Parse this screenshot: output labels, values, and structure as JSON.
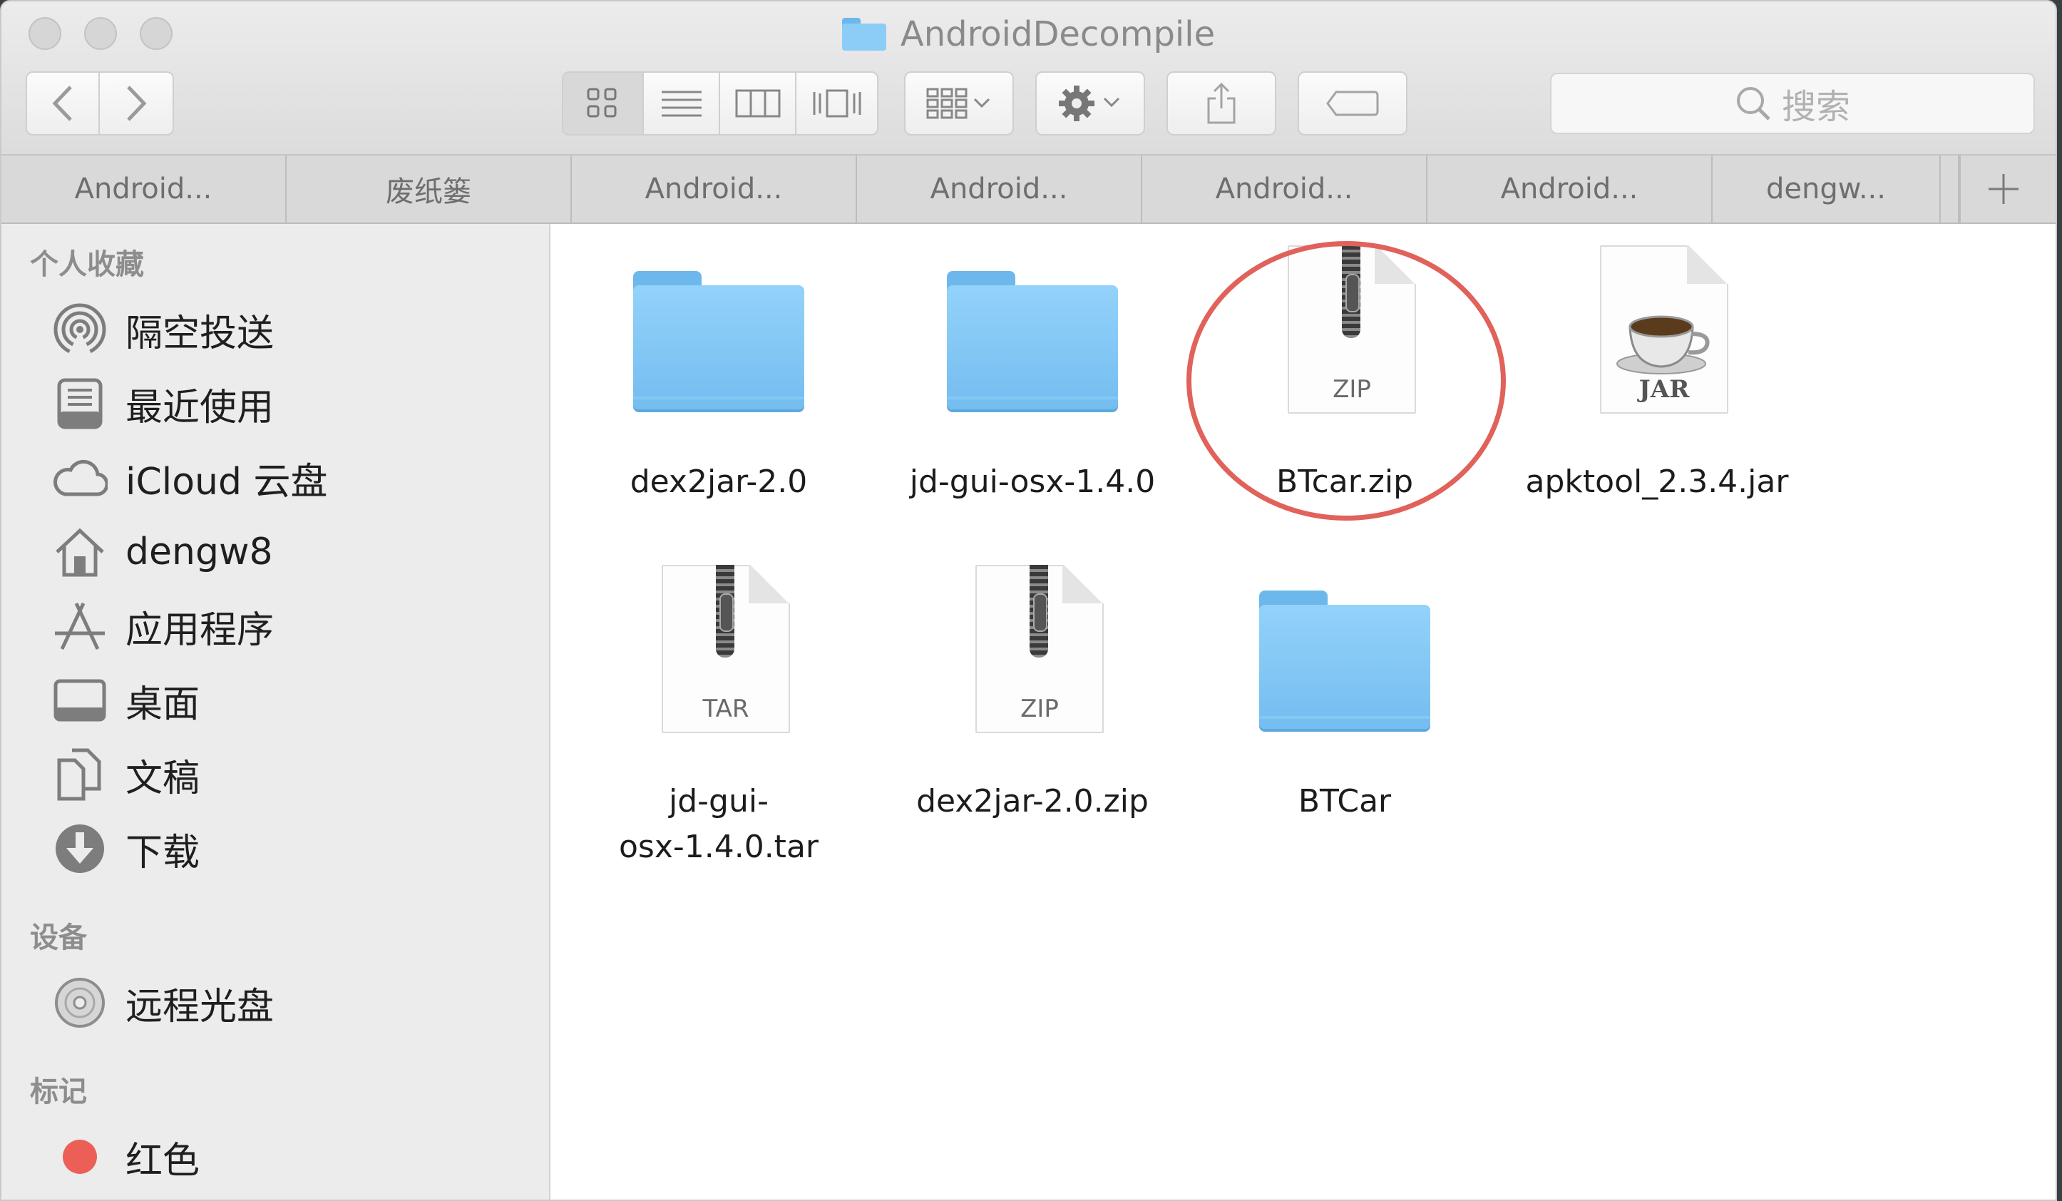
{
  "window": {
    "title": "AndroidDecompile"
  },
  "toolbar": {
    "back_icon": "chevron-left-icon",
    "forward_icon": "chevron-right-icon",
    "view_modes": [
      "icon-view",
      "list-view",
      "column-view",
      "cover-flow-view"
    ],
    "search_placeholder": "搜索"
  },
  "tabs": [
    {
      "label": "Android..."
    },
    {
      "label": "废纸篓"
    },
    {
      "label": "Android..."
    },
    {
      "label": "Android..."
    },
    {
      "label": "Android..."
    },
    {
      "label": "Android..."
    },
    {
      "label": "dengw..."
    }
  ],
  "sidebar": {
    "favorites_heading": "个人收藏",
    "favorites": [
      {
        "label": "隔空投送",
        "icon": "airdrop-icon"
      },
      {
        "label": "最近使用",
        "icon": "recents-icon"
      },
      {
        "label": "iCloud 云盘",
        "icon": "cloud-icon"
      },
      {
        "label": "dengw8",
        "icon": "home-icon"
      },
      {
        "label": "应用程序",
        "icon": "applications-icon"
      },
      {
        "label": "桌面",
        "icon": "desktop-icon"
      },
      {
        "label": "文稿",
        "icon": "documents-icon"
      },
      {
        "label": "下载",
        "icon": "download-icon"
      }
    ],
    "devices_heading": "设备",
    "devices": [
      {
        "label": "远程光盘",
        "icon": "disc-icon"
      }
    ],
    "tags_heading": "标记",
    "tags": [
      {
        "label": "红色",
        "color": "#ec5f57"
      }
    ]
  },
  "files": [
    {
      "name": "dex2jar-2.0",
      "kind": "folder"
    },
    {
      "name": "jd-gui-osx-1.4.0",
      "kind": "folder"
    },
    {
      "name": "BTcar.zip",
      "kind": "archive",
      "ext": "ZIP",
      "highlighted": true
    },
    {
      "name": "apktool_2.3.4.jar",
      "kind": "jar",
      "ext": "JAR"
    },
    {
      "name": "jd-gui-osx-1.4.0.tar",
      "name_line1": "jd-gui-",
      "name_line2": "osx-1.4.0.tar",
      "kind": "archive",
      "ext": "TAR"
    },
    {
      "name": "dex2jar-2.0.zip",
      "kind": "archive",
      "ext": "ZIP"
    },
    {
      "name": "BTCar",
      "kind": "folder"
    }
  ],
  "colors": {
    "folder_blue": "#7cc3f3",
    "highlight_ring": "#e0625b",
    "red_tag": "#ec5f57"
  }
}
